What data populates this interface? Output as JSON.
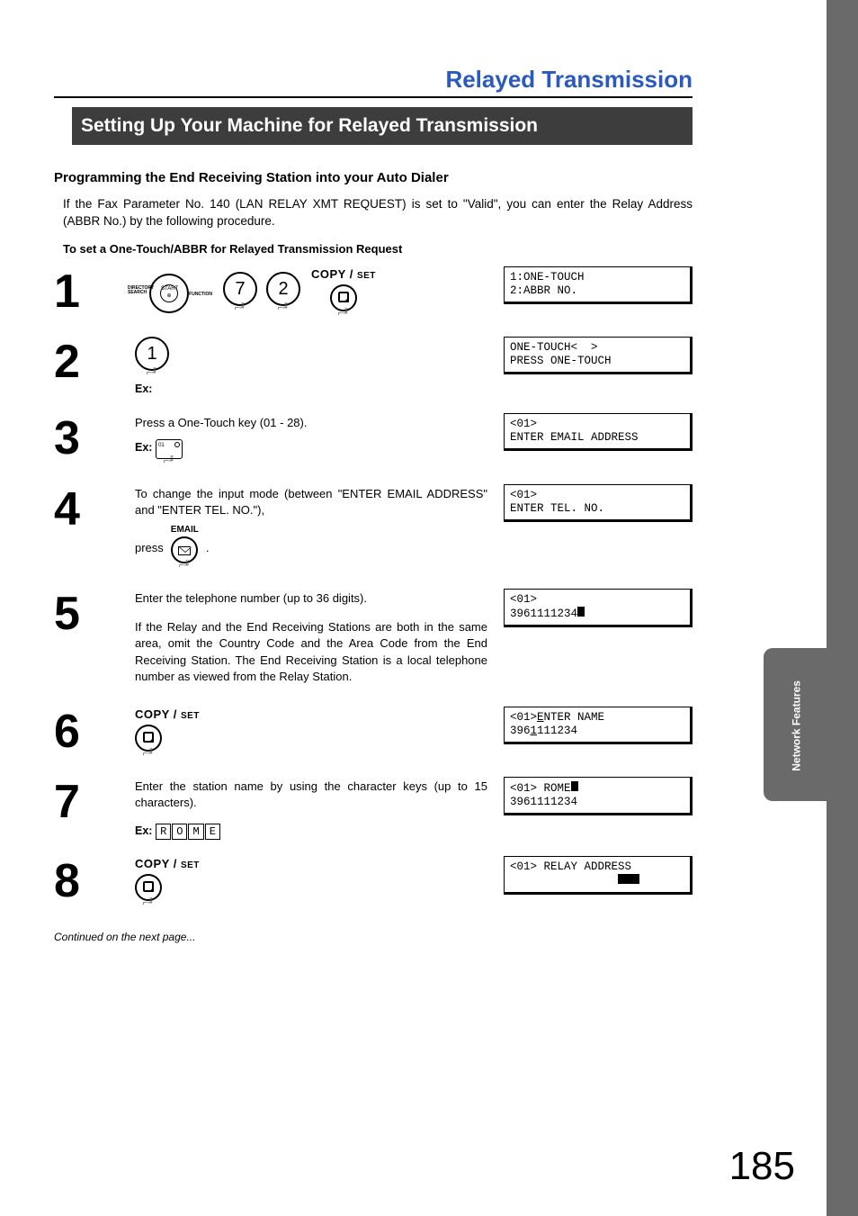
{
  "header": {
    "title": "Relayed Transmission"
  },
  "section": {
    "title": "Setting Up Your Machine for Relayed Transmission"
  },
  "side_tab": "Network Features",
  "sub": {
    "heading": "Programming the End Receiving Station into your Auto Dialer",
    "intro": "If the Fax Parameter No. 140 (LAN RELAY XMT REQUEST) is set to \"Valid\", you can enter the Relay Address (ABBR No.) by the following procedure.",
    "sub2": "To set a One-Touch/ABBR for Relayed Transmission Request"
  },
  "labels": {
    "copy": "COPY",
    "set": "SET",
    "ex": "Ex:",
    "email": "EMAIL",
    "start": "START",
    "directory_search": "DIRECTORY SEARCH",
    "function": "FUNCTION"
  },
  "steps": [
    {
      "n": "1",
      "icons": {
        "type": "dial_7_2_copy"
      },
      "lcd": [
        "1:ONE-TOUCH\n2:ABBR NO."
      ]
    },
    {
      "n": "2",
      "icons": {
        "type": "round1"
      },
      "ex_after_icon": true,
      "lcd": [
        "ONE-TOUCH<  >\nPRESS ONE-TOUCH"
      ]
    },
    {
      "n": "3",
      "text": [
        "Press a One-Touch key (01 - 28)."
      ],
      "icons": {
        "type": "keybox01"
      },
      "ex_before_icon": true,
      "lcd": [
        "<01>\nENTER EMAIL ADDRESS"
      ]
    },
    {
      "n": "4",
      "text": [
        "To change the input mode (between \"ENTER EMAIL ADDRESS\" and \"ENTER TEL. NO.\"),"
      ],
      "press_email": true,
      "lcd": [
        "<01>\nENTER TEL. NO."
      ]
    },
    {
      "n": "5",
      "text": [
        "Enter the telephone number (up to 36 digits).",
        "If the Relay and the End Receiving Stations are both in the same area, omit the Country Code and the Area Code from the End Receiving Station. The End Receiving Station is a local telephone number as viewed from the Relay Station."
      ],
      "lcd": [
        "<01>\n3961111234▮"
      ]
    },
    {
      "n": "6",
      "icons": {
        "type": "copyset"
      },
      "lcd": [
        "<01>ENTER NAME\n3961111234"
      ],
      "lcd_underline": "E"
    },
    {
      "n": "7",
      "text": [
        "Enter the station name by using the character keys (up to 15 characters)."
      ],
      "ex_keys": [
        "R",
        "O",
        "M",
        "E"
      ],
      "lcd": [
        "<01> ROME▮\n3961111234"
      ]
    },
    {
      "n": "8",
      "icons": {
        "type": "copyset"
      },
      "lcd": [
        "<01> RELAY ADDRESS\n                ▮▮▮"
      ]
    }
  ],
  "footer": {
    "continued": "Continued on the next page...",
    "page": "185"
  }
}
